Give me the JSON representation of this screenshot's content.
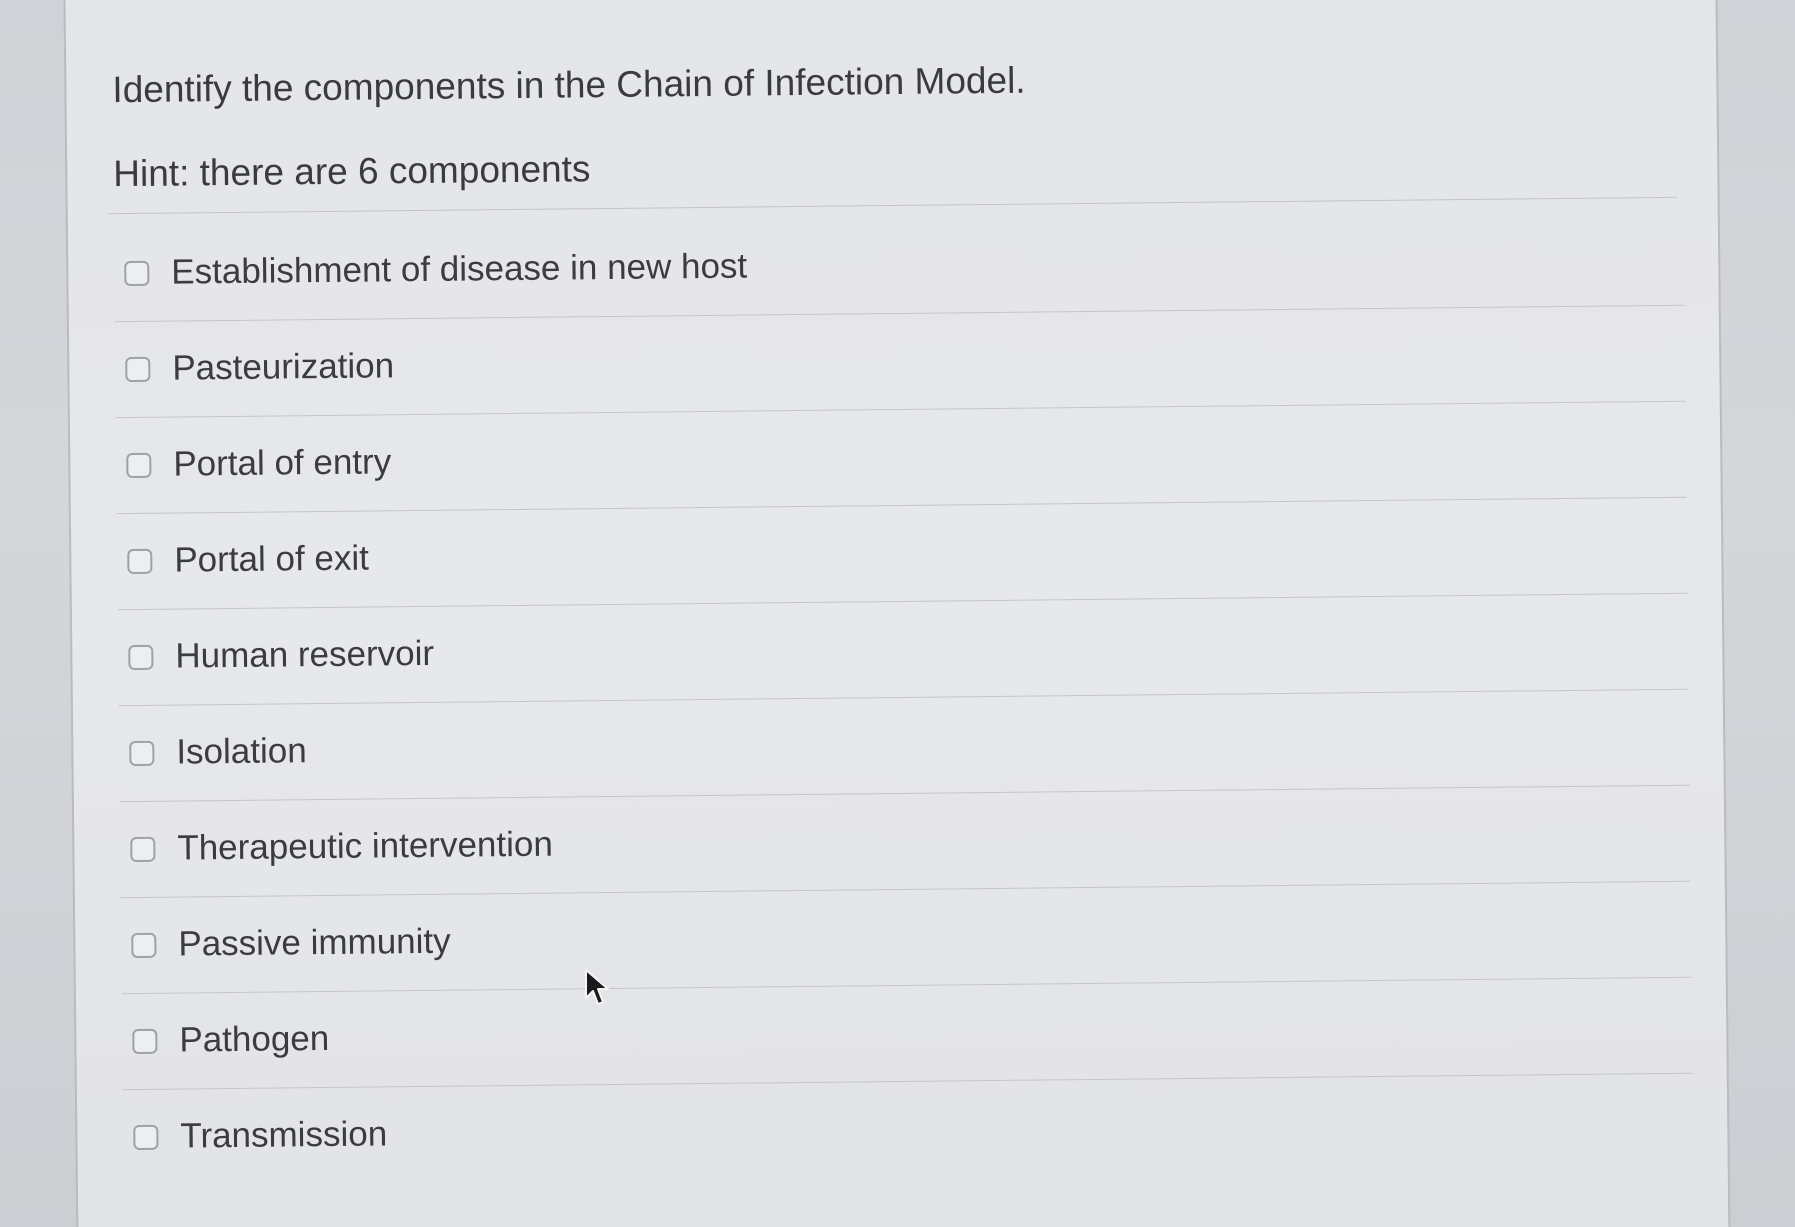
{
  "question": {
    "title": "Identify the components in the Chain of Infection Model.",
    "hint": "Hint: there are 6 components"
  },
  "options": [
    {
      "label": "Establishment of disease in new host",
      "checked": false
    },
    {
      "label": "Pasteurization",
      "checked": false
    },
    {
      "label": "Portal of entry",
      "checked": false
    },
    {
      "label": "Portal of exit",
      "checked": false
    },
    {
      "label": "Human reservoir",
      "checked": false
    },
    {
      "label": "Isolation",
      "checked": false
    },
    {
      "label": "Therapeutic intervention",
      "checked": false
    },
    {
      "label": "Passive immunity",
      "checked": false
    },
    {
      "label": "Pathogen",
      "checked": false
    },
    {
      "label": "Transmission",
      "checked": false
    }
  ],
  "icons": {
    "pointer": "mouse-pointer-icon"
  },
  "colors": {
    "text": "#3b3c40",
    "background": "#e5e6e9",
    "checkbox_border": "#9ea2a7"
  }
}
